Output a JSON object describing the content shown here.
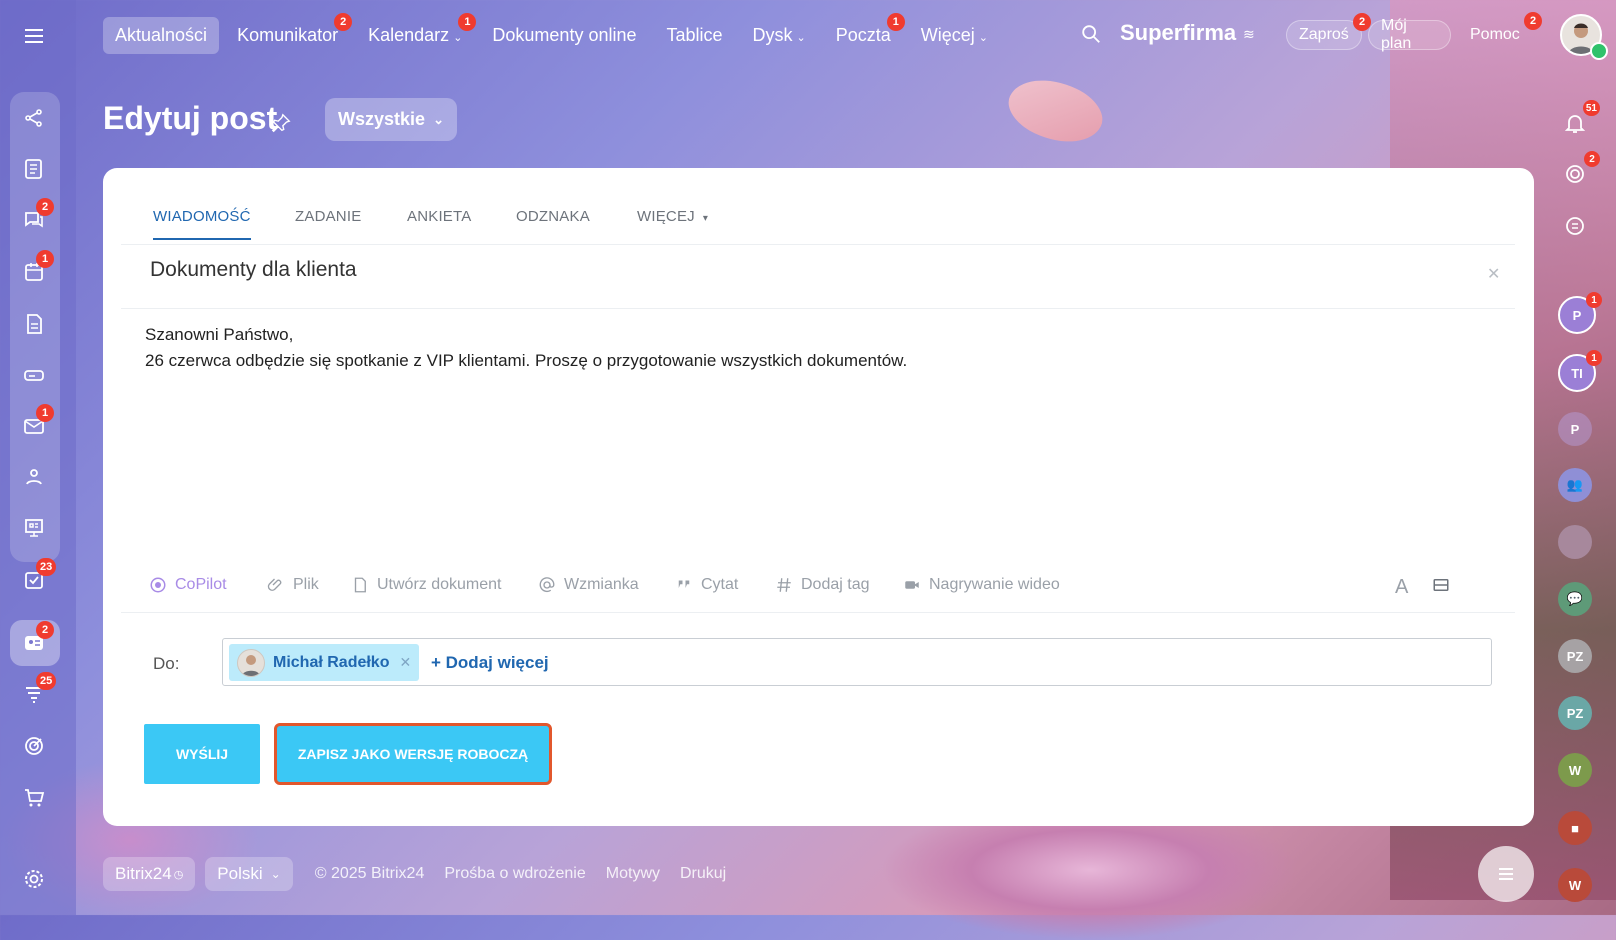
{
  "topnav": {
    "items": [
      {
        "label": "Aktualności",
        "badge": ""
      },
      {
        "label": "Komunikator",
        "badge": "2"
      },
      {
        "label": "Kalendarz",
        "badge": "1"
      },
      {
        "label": "Dokumenty online",
        "badge": ""
      },
      {
        "label": "Tablice",
        "badge": ""
      },
      {
        "label": "Dysk",
        "badge": ""
      },
      {
        "label": "Poczta",
        "badge": "1"
      },
      {
        "label": "Więcej",
        "badge": ""
      }
    ],
    "company": "Superfirma",
    "invite": {
      "label": "Zaproś",
      "badge": "2"
    },
    "plan": "Mój plan",
    "help": {
      "label": "Pomoc",
      "badge": "2"
    }
  },
  "sidebar": {
    "badges": {
      "chats": "2",
      "calendar": "1",
      "mail": "1",
      "tasks": "23",
      "feed": "2",
      "funnel": "25"
    }
  },
  "rail": {
    "notifications_badge": "51",
    "target_badge": "2",
    "users": [
      {
        "initials": "P",
        "badge": "1",
        "color": "#9b7fd6"
      },
      {
        "initials": "TI",
        "badge": "1",
        "color": "#9b7fd6"
      },
      {
        "initials": "P",
        "badge": "",
        "color": "#b69bd8"
      },
      {
        "initials": "PZ",
        "badge": "",
        "color": "#a6a2a4"
      },
      {
        "initials": "PZ",
        "badge": "",
        "color": "#6aa7a6"
      },
      {
        "initials": "W",
        "badge": "",
        "color": "#7d9a4c"
      },
      {
        "initials": "W",
        "badge": "",
        "color": "#b94a3a"
      }
    ]
  },
  "page": {
    "title": "Edytuj post",
    "filter": "Wszystkie"
  },
  "editor": {
    "tabs": [
      "WIADOMOŚĆ",
      "ZADANIE",
      "ANKIETA",
      "ODZNAKA",
      "WIĘCEJ"
    ],
    "title": "Dokumenty dla klienta",
    "body_line1": "Szanowni Państwo,",
    "body_line2": "26 czerwca odbędzie się spotkanie z VIP klientami. Proszę o przygotowanie wszystkich dokumentów.",
    "tools": {
      "copilot": "CoPilot",
      "file": "Plik",
      "create_doc": "Utwórz dokument",
      "mention": "Wzmianka",
      "quote": "Cytat",
      "tag": "Dodaj tag",
      "video": "Nagrywanie wideo",
      "format": "A"
    },
    "to_label": "Do:",
    "recipient": "Michał Radełko",
    "add_more": "+ Dodaj więcej",
    "send": "WYŚLIJ",
    "save_draft": "ZAPISZ JAKO WERSJĘ ROBOCZĄ"
  },
  "footer": {
    "brand": "Bitrix24",
    "language": "Polski",
    "copyright": "© 2025 Bitrix24",
    "links": [
      "Prośba o wdrożenie",
      "Motywy",
      "Drukuj"
    ]
  }
}
